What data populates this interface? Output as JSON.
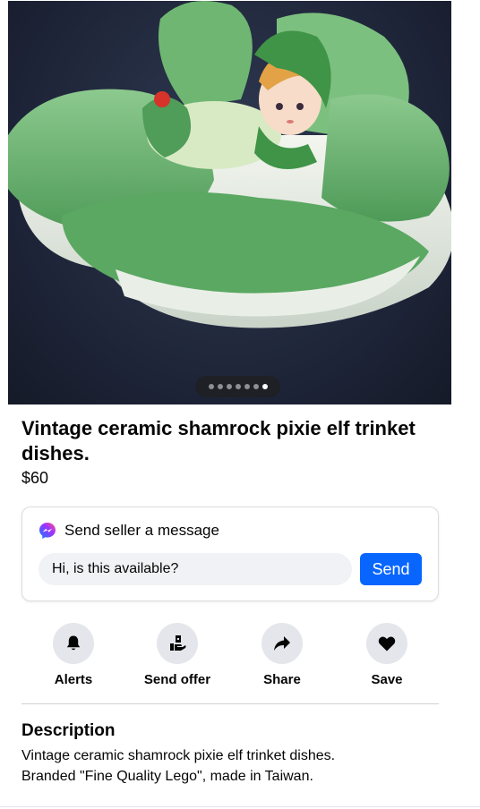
{
  "photo": {
    "alt": "Green ceramic shamrock dish with pixie elf figurine",
    "page_count": 7,
    "active_page": 7
  },
  "listing": {
    "title": "Vintage ceramic shamrock pixie elf trinket dishes.",
    "price": "$60"
  },
  "message": {
    "icon": "messenger-icon",
    "heading": "Send seller a message",
    "input_value": "Hi, is this available?",
    "send_label": "Send"
  },
  "actions": [
    {
      "icon": "bell-icon",
      "label": "Alerts"
    },
    {
      "icon": "send-offer-icon",
      "label": "Send offer"
    },
    {
      "icon": "share-arrow-icon",
      "label": "Share"
    },
    {
      "icon": "heart-icon",
      "label": "Save"
    }
  ],
  "description": {
    "heading": "Description",
    "lines": [
      "Vintage ceramic shamrock pixie elf trinket dishes.",
      "Branded \"Fine Quality Lego\", made in Taiwan."
    ]
  },
  "colors": {
    "primary_blue": "#0866ff",
    "icon_circle_bg": "#e4e6eb",
    "input_bg": "#f0f2f5"
  }
}
